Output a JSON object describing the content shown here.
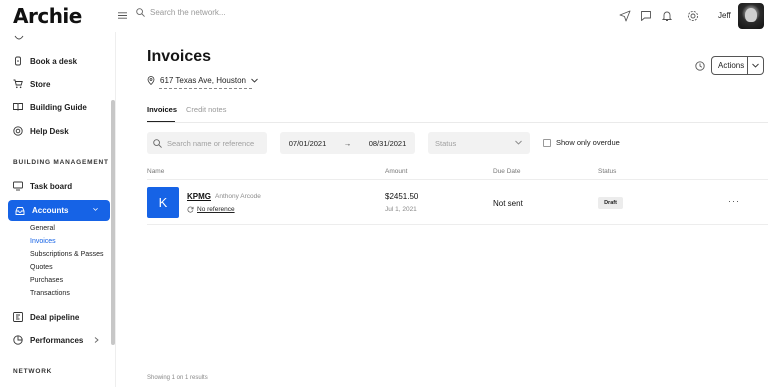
{
  "app": {
    "logo": "Archie"
  },
  "header": {
    "search_placeholder": "Search the network...",
    "user_name": "Jeff"
  },
  "sidebar": {
    "items_top": [
      {
        "label": "Book a desk",
        "icon": "desk-lock-icon"
      },
      {
        "label": "Store",
        "icon": "cart-icon"
      },
      {
        "label": "Building Guide",
        "icon": "book-icon"
      },
      {
        "label": "Help Desk",
        "icon": "lifebuoy-icon"
      }
    ],
    "section_building": "BUILDING MANAGEMENT",
    "task_board": "Task board",
    "accounts": "Accounts",
    "subitems": [
      "General",
      "Invoices",
      "Subscriptions & Passes",
      "Quotes",
      "Purchases",
      "Transactions"
    ],
    "deal_pipeline": "Deal pipeline",
    "performances": "Performances",
    "section_network": "NETWORK"
  },
  "main": {
    "title": "Invoices",
    "location": "617 Texas Ave, Houston",
    "actions_label": "Actions",
    "tabs": [
      "Invoices",
      "Credit notes"
    ],
    "filters": {
      "search_placeholder": "Search name or reference",
      "date_from": "07/01/2021",
      "date_arrow": "→",
      "date_to": "08/31/2021",
      "status_placeholder": "Status",
      "overdue_label": "Show only overdue"
    },
    "columns": [
      "Name",
      "Amount",
      "Due Date",
      "Status"
    ],
    "rows": [
      {
        "initial": "K",
        "client": "KPMG",
        "contact": "Anthony Arcode",
        "reference": "No reference",
        "amount": "$2451.50",
        "date": "Jul 1, 2021",
        "due": "Not sent",
        "status": "Draft",
        "more": "···"
      }
    ],
    "results_text": "Showing 1 on 1 results"
  },
  "colors": {
    "accent": "#1663e6",
    "badge": "#ececec"
  }
}
